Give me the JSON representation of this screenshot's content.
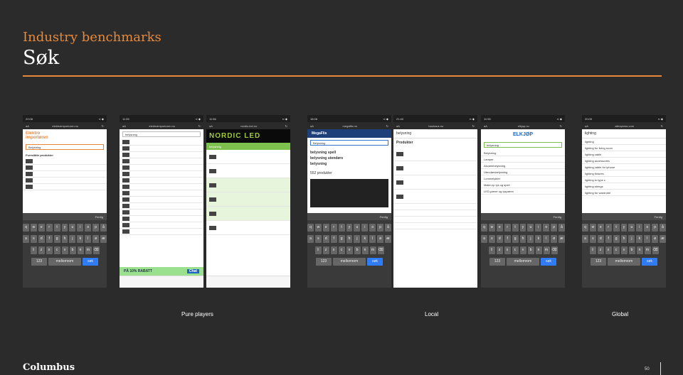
{
  "header": {
    "eyebrow": "Industry benchmarks",
    "title": "Søk"
  },
  "captions": {
    "pure": "Pure players",
    "local": "Local",
    "global": "Global"
  },
  "footer": {
    "logo": "Columbus",
    "page": "50"
  },
  "keyboard": {
    "done": "Ferdig",
    "row1": [
      "q",
      "w",
      "e",
      "r",
      "t",
      "y",
      "u",
      "i",
      "o",
      "p",
      "å"
    ],
    "row2": [
      "a",
      "s",
      "d",
      "f",
      "g",
      "h",
      "j",
      "k",
      "l",
      "ø",
      "æ"
    ],
    "row3": [
      "⇧",
      "z",
      "x",
      "c",
      "v",
      "b",
      "n",
      "m",
      "⌫"
    ],
    "num": "123",
    "space": "mellomrom",
    "go": "søk"
  },
  "phones": [
    {
      "time": "22:08",
      "url": "elektroimportoren.no",
      "search": "Belysning",
      "heading": "Foreslåtte produkter"
    },
    {
      "time": "11:55",
      "url": "elektroimportoren.no",
      "search": "belysning",
      "banner": "PÅ 10% RABATT",
      "chat": "Chat"
    },
    {
      "time": "11:56",
      "url": "nordic-led.no",
      "brand": "NORDIC LED",
      "search": "belysning"
    },
    {
      "time": "18:08",
      "url": "megaflis.no",
      "brand": "MegaFlis",
      "search": "Belysning",
      "items": [
        "belysning spell",
        "belysning utendørs",
        "belysning"
      ],
      "count": "552 produkter"
    },
    {
      "time": "21:40",
      "url": "bauhaus.no",
      "search": "belysning",
      "section": "Produkter"
    },
    {
      "time": "11:55",
      "url": "elkjop.no",
      "brand": "ELKJØP",
      "search": "belysning",
      "items": [
        "Belysning",
        "Lamper",
        "Akvariebelysning",
        "Utendørsbelysning",
        "Lommelykter",
        "Make-up lys og speil",
        "LED-pærer og lyspærer"
      ]
    },
    {
      "time": "20:09",
      "url": "aliexpress.com",
      "search": "lighting",
      "items": [
        "lighting",
        "lighting for living room",
        "lighting cable",
        "lighting accessories",
        "lighting cable for iphone",
        "lighting fixtures",
        "lighting to type c",
        "lighting strings",
        "lighting for wardrobe"
      ]
    }
  ]
}
